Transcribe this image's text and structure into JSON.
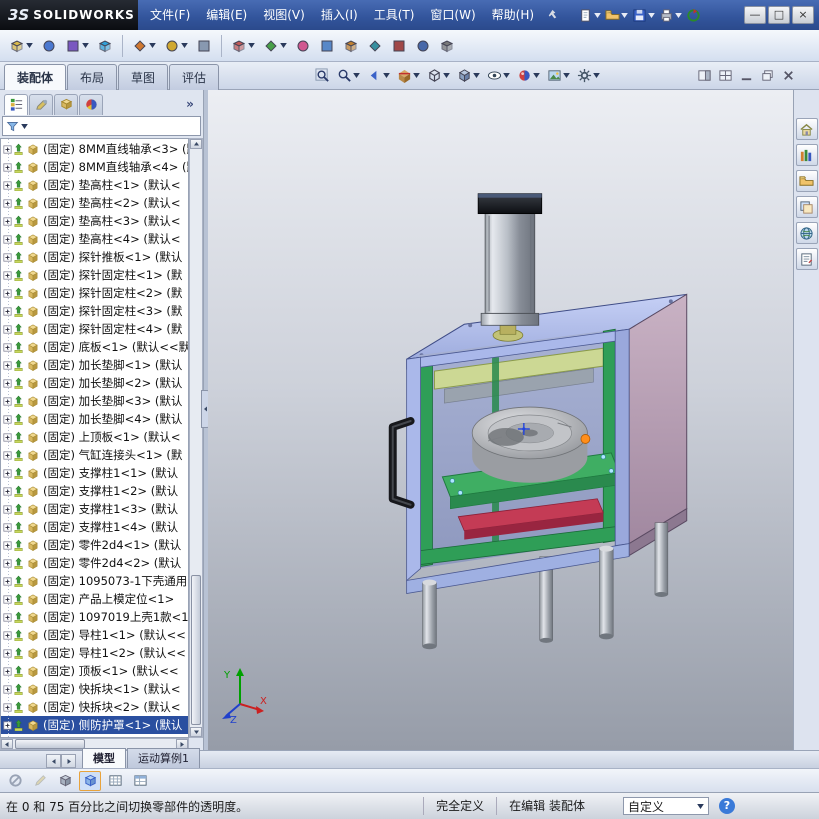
{
  "titlebar": {
    "brand_prefix": "3S",
    "brand": "SOLIDWORKS",
    "menus": [
      {
        "label": "文件(F)"
      },
      {
        "label": "编辑(E)"
      },
      {
        "label": "视图(V)"
      },
      {
        "label": "插入(I)"
      },
      {
        "label": "工具(T)"
      },
      {
        "label": "窗口(W)"
      },
      {
        "label": "帮助(H)"
      }
    ],
    "quick_icons": [
      {
        "name": "new-document",
        "caret": true
      },
      {
        "name": "open",
        "caret": true
      },
      {
        "name": "save",
        "caret": true
      },
      {
        "name": "print",
        "caret": true
      },
      {
        "name": "rebuild",
        "caret": false
      }
    ],
    "window_buttons": [
      {
        "name": "minimize",
        "glyph": "—"
      },
      {
        "name": "maximize",
        "glyph": "□"
      },
      {
        "name": "close",
        "glyph": "×"
      }
    ]
  },
  "toolbar": {
    "icons": [
      {
        "name": "insert-components",
        "shape": "cube",
        "color": "#d8b84a",
        "caret": true
      },
      {
        "name": "mate",
        "shape": "circle",
        "color": "#4a78d0",
        "caret": false
      },
      {
        "name": "linear-component-pattern",
        "shape": "square",
        "color": "#7a58c0",
        "caret": true
      },
      {
        "name": "smart-fasteners",
        "shape": "cube",
        "color": "#30a0d8",
        "caret": false
      },
      {
        "sep": true
      },
      {
        "name": "move-component",
        "shape": "diamond",
        "color": "#d07830",
        "caret": true
      },
      {
        "name": "rotate-component",
        "shape": "circle",
        "color": "#d0a830",
        "caret": true
      },
      {
        "name": "show-hidden-components",
        "shape": "square",
        "color": "#8898b0",
        "caret": false
      },
      {
        "sep": true
      },
      {
        "name": "assembly-features",
        "shape": "cube",
        "color": "#c05858",
        "caret": true
      },
      {
        "name": "reference-geometry",
        "shape": "diamond",
        "color": "#48a048",
        "caret": true
      },
      {
        "name": "new-motion-study",
        "shape": "circle",
        "color": "#d05890",
        "caret": false
      },
      {
        "name": "bill-of-materials",
        "shape": "square",
        "color": "#5888c8",
        "caret": false
      },
      {
        "name": "exploded-view",
        "shape": "cube",
        "color": "#c08030",
        "caret": false
      },
      {
        "name": "explode-line-sketch",
        "shape": "diamond",
        "color": "#3890a0",
        "caret": false
      },
      {
        "name": "interference-detection",
        "shape": "square",
        "color": "#a04848",
        "caret": false
      },
      {
        "name": "measure",
        "shape": "circle",
        "color": "#4868a8",
        "caret": false
      },
      {
        "name": "mass-properties",
        "shape": "cube",
        "color": "#787878",
        "caret": false
      }
    ]
  },
  "command_bar": {
    "tabs": [
      {
        "label": "装配体",
        "active": true
      },
      {
        "label": "布局",
        "active": false
      },
      {
        "label": "草图",
        "active": false
      },
      {
        "label": "评估",
        "active": false
      }
    ],
    "headsup": [
      {
        "name": "zoom-fit",
        "caret": false
      },
      {
        "name": "zoom-area",
        "caret": true
      },
      {
        "name": "previous-view",
        "caret": true
      },
      {
        "name": "section-view",
        "caret": true
      },
      {
        "name": "view-orientation",
        "caret": true
      },
      {
        "name": "display-style",
        "caret": true
      },
      {
        "name": "hide-show-items",
        "caret": true
      },
      {
        "name": "edit-appearance",
        "caret": true
      },
      {
        "name": "apply-scene",
        "caret": true
      },
      {
        "name": "view-settings",
        "caret": true
      }
    ],
    "pane_buttons": [
      {
        "name": "show-display-pane"
      },
      {
        "name": "split-view"
      },
      {
        "name": "minimize-pane"
      },
      {
        "name": "restore-pane"
      },
      {
        "name": "close-pane"
      }
    ]
  },
  "task_pane": {
    "icons": [
      {
        "name": "solidworks-resources"
      },
      {
        "name": "design-library"
      },
      {
        "name": "file-explorer"
      },
      {
        "name": "view-palette"
      },
      {
        "name": "appearances-scenes"
      },
      {
        "name": "custom-properties"
      }
    ]
  },
  "panel": {
    "header_icons": [
      {
        "name": "feature-manager",
        "active": true
      },
      {
        "name": "property-manager",
        "active": false
      },
      {
        "name": "configuration-manager",
        "active": false
      },
      {
        "name": "display-manager",
        "active": false
      }
    ],
    "overflow_label": "»",
    "filter": {
      "value": ""
    },
    "tree": {
      "selected_index": 32,
      "items": [
        {
          "label": "(固定) 8MM直线轴承<3> (默"
        },
        {
          "label": "(固定) 8MM直线轴承<4> (默"
        },
        {
          "label": "(固定) 垫高柱<1> (默认<"
        },
        {
          "label": "(固定) 垫高柱<2> (默认<"
        },
        {
          "label": "(固定) 垫高柱<3> (默认<"
        },
        {
          "label": "(固定) 垫高柱<4> (默认<"
        },
        {
          "label": "(固定) 探针推板<1> (默认"
        },
        {
          "label": "(固定) 探针固定柱<1> (默"
        },
        {
          "label": "(固定) 探针固定柱<2> (默"
        },
        {
          "label": "(固定) 探针固定柱<3> (默"
        },
        {
          "label": "(固定) 探针固定柱<4> (默"
        },
        {
          "label": "(固定) 底板<1> (默认<<默"
        },
        {
          "label": "(固定) 加长垫脚<1> (默认"
        },
        {
          "label": "(固定) 加长垫脚<2> (默认"
        },
        {
          "label": "(固定) 加长垫脚<3> (默认"
        },
        {
          "label": "(固定) 加长垫脚<4> (默认"
        },
        {
          "label": "(固定) 上顶板<1> (默认<"
        },
        {
          "label": "(固定) 气缸连接头<1> (默"
        },
        {
          "label": "(固定) 支撑柱1<1> (默认"
        },
        {
          "label": "(固定) 支撑柱1<2> (默认"
        },
        {
          "label": "(固定) 支撑柱1<3> (默认"
        },
        {
          "label": "(固定) 支撑柱1<4> (默认"
        },
        {
          "label": "(固定) 零件2d4<1> (默认"
        },
        {
          "label": "(固定) 零件2d4<2> (默认"
        },
        {
          "label": "(固定) 1095073-1下壳通用"
        },
        {
          "label": "(固定) 产品上模定位<1>"
        },
        {
          "label": "(固定) 1097019上壳1款<1"
        },
        {
          "label": "(固定) 导柱1<1> (默认<<"
        },
        {
          "label": "(固定) 导柱1<2> (默认<<"
        },
        {
          "label": "(固定) 顶板<1> (默认<<"
        },
        {
          "label": "(固定) 快拆块<1> (默认<"
        },
        {
          "label": "(固定) 快拆块<2> (默认<"
        },
        {
          "label": "(固定) 侧防护罩<1> (默认"
        }
      ]
    },
    "tabs": [
      {
        "label": "模型",
        "active": true
      },
      {
        "label": "运动算例1",
        "active": false
      }
    ]
  },
  "viewport": {
    "triad": {
      "x": "X",
      "y": "Y",
      "z": "Z"
    }
  },
  "bottom_toolbar": {
    "icons": [
      {
        "name": "isolate"
      },
      {
        "name": "edit-component",
        "disabled": true
      },
      {
        "name": "change-transparency"
      },
      {
        "name": "assembly-transparency",
        "active": true
      },
      {
        "name": "simulation-grid"
      },
      {
        "name": "evaluate-table"
      }
    ]
  },
  "statusbar": {
    "message": "在 0 和 75 百分比之间切换零部件的透明度。",
    "define_state": "完全定义",
    "edit_state": "在编辑 装配体",
    "custom_label": "自定义",
    "help_glyph": "?"
  },
  "colors": {
    "selection": "#2a4fa0",
    "box_top": "#b3c0ee",
    "box_right": "#c0a8ba",
    "frame_green": "#2f9e57",
    "plate_green": "#3fae63",
    "part_red": "#c43b55",
    "accent_orange": "#ff8e1a"
  }
}
